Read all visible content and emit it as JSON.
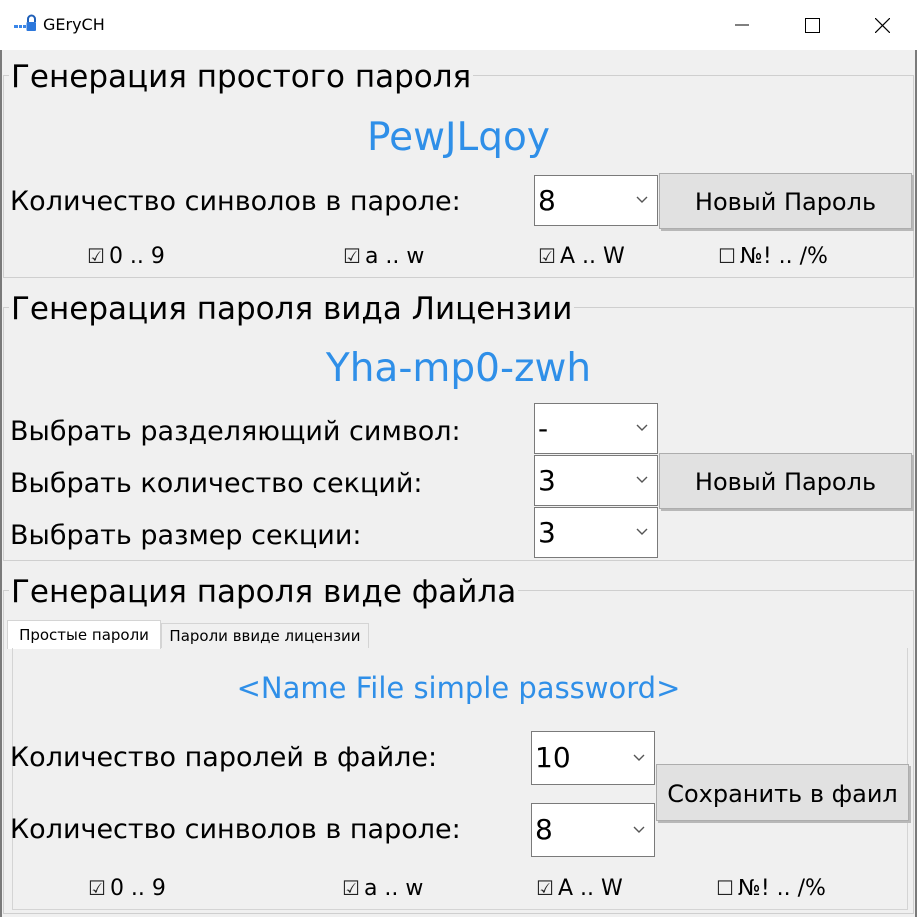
{
  "window": {
    "title": "GEryCH",
    "icon": "lock-key-icon",
    "controls": [
      "minimize-icon",
      "maximize-icon",
      "close-icon"
    ]
  },
  "simple": {
    "title": "Генерация простого пароля",
    "password": "PewJLqoy",
    "length_label": "Количество синволов в пароле:",
    "length_value": "8",
    "button": "Новый Пароль",
    "checks": [
      {
        "label": "0 .. 9",
        "checked": true
      },
      {
        "label": "a .. w",
        "checked": true
      },
      {
        "label": "A .. W",
        "checked": true
      },
      {
        "label": "№! .. /%",
        "checked": false
      }
    ]
  },
  "license": {
    "title": "Генерация пароля вида Лицензии",
    "password": "Yha-mp0-zwh",
    "separator_label": "Выбрать разделяющий символ:",
    "separator_value": "-",
    "sections_label": "Выбрать количество секций:",
    "sections_value": "3",
    "size_label": "Выбрать размер секции:",
    "size_value": "3",
    "button": "Новый Пароль"
  },
  "file": {
    "title": "Генерация пароля виде файла",
    "tabs": [
      {
        "label": "Простые пароли",
        "active": true
      },
      {
        "label": "Пароли ввиде лицензии",
        "active": false
      }
    ],
    "file_name": "<Name File simple password>",
    "count_label": "Количество паролей в файле:",
    "count_value": "10",
    "length_label": "Количество синволов в пароле:",
    "length_value": "8",
    "button": "Сохранить в фаил",
    "checks": [
      {
        "label": "0 .. 9",
        "checked": true
      },
      {
        "label": "a .. w",
        "checked": true
      },
      {
        "label": "A .. W",
        "checked": true
      },
      {
        "label": "№! .. /%",
        "checked": false
      }
    ]
  },
  "colors": {
    "accent": "#2f8fe8",
    "background": "#f0f0f0",
    "title_bar": "#ffffff"
  }
}
